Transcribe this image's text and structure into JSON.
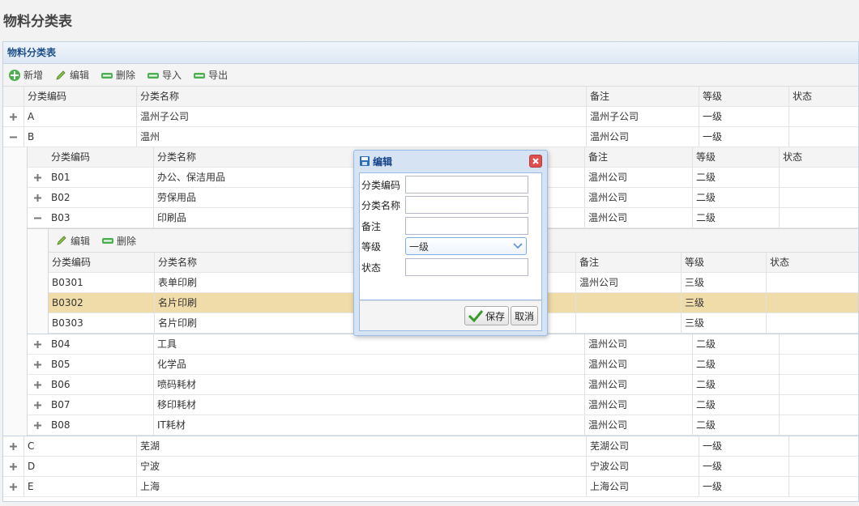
{
  "page": {
    "title": "物料分类表"
  },
  "panel": {
    "title": "物料分类表"
  },
  "toolbar": {
    "add": "新增",
    "edit": "编辑",
    "delete": "删除",
    "import": "导入",
    "export": "导出"
  },
  "columns": {
    "code": "分类编码",
    "name": "分类名称",
    "remark": "备注",
    "level": "等级",
    "status": "状态"
  },
  "top_rows": [
    {
      "code": "A",
      "name": "温州子公司",
      "remark": "温州子公司",
      "level": "一级",
      "status": "",
      "expander": "plus"
    },
    {
      "code": "B",
      "name": "温州",
      "remark": "温州公司",
      "level": "一级",
      "status": "",
      "expander": "minus"
    }
  ],
  "b_children_top": [
    {
      "code": "B01",
      "name": "办公、保洁用品",
      "remark": "温州公司",
      "level": "二级",
      "status": "",
      "expander": "plus"
    },
    {
      "code": "B02",
      "name": "劳保用品",
      "remark": "温州公司",
      "level": "二级",
      "status": "",
      "expander": "plus"
    },
    {
      "code": "B03",
      "name": "印刷品",
      "remark": "温州公司",
      "level": "二级",
      "status": "",
      "expander": "minus"
    }
  ],
  "b03_toolbar": {
    "edit": "编辑",
    "delete": "删除"
  },
  "b03_children": [
    {
      "code": "B0301",
      "name": "表单印刷",
      "remark": "温州公司",
      "level": "三级",
      "status": ""
    },
    {
      "code": "B0302",
      "name": "名片印刷",
      "remark": "",
      "level": "三级",
      "status": ""
    },
    {
      "code": "B0303",
      "name": "名片印刷",
      "remark": "",
      "level": "三级",
      "status": ""
    }
  ],
  "b_children_bottom": [
    {
      "code": "B04",
      "name": "工具",
      "remark": "温州公司",
      "level": "二级",
      "status": "",
      "expander": "plus"
    },
    {
      "code": "B05",
      "name": "化学品",
      "remark": "温州公司",
      "level": "二级",
      "status": "",
      "expander": "plus"
    },
    {
      "code": "B06",
      "name": "喷码耗材",
      "remark": "温州公司",
      "level": "二级",
      "status": "",
      "expander": "plus"
    },
    {
      "code": "B07",
      "name": "移印耗材",
      "remark": "温州公司",
      "level": "二级",
      "status": "",
      "expander": "plus"
    },
    {
      "code": "B08",
      "name": "IT耗材",
      "remark": "温州公司",
      "level": "二级",
      "status": "",
      "expander": "plus"
    }
  ],
  "bottom_rows": [
    {
      "code": "C",
      "name": "芜湖",
      "remark": "芜湖公司",
      "level": "一级",
      "status": "",
      "expander": "plus"
    },
    {
      "code": "D",
      "name": "宁波",
      "remark": "宁波公司",
      "level": "一级",
      "status": "",
      "expander": "plus"
    },
    {
      "code": "E",
      "name": "上海",
      "remark": "上海公司",
      "level": "一级",
      "status": "",
      "expander": "plus"
    }
  ],
  "dialog": {
    "title": "编辑",
    "fields": {
      "code_label": "分类编码",
      "code_value": "",
      "name_label": "分类名称",
      "name_value": "",
      "remark_label": "备注",
      "remark_value": "",
      "level_label": "等级",
      "level_value": "一级",
      "status_label": "状态",
      "status_value": ""
    },
    "save": "保存",
    "cancel": "取消"
  },
  "colors": {
    "selected_row": "#f0dca8",
    "accent": "#15428b",
    "panel_border": "#c5d4e4"
  }
}
